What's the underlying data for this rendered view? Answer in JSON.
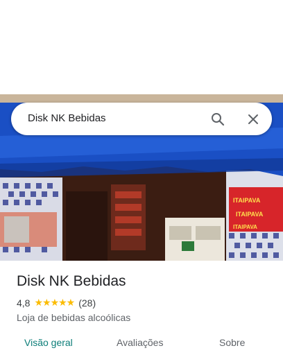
{
  "search": {
    "value": "Disk NK Bebidas"
  },
  "place": {
    "name": "Disk NK Bebidas",
    "rating": "4,8",
    "stars": "★★★★★",
    "review_count": "(28)",
    "category": "Loja de bebidas alcoólicas"
  },
  "tabs": [
    {
      "label": "Visão geral",
      "active": true
    },
    {
      "label": "Avaliações",
      "active": false
    },
    {
      "label": "Sobre",
      "active": false
    }
  ],
  "photo": {
    "signs": [
      "ITAIPAVA",
      "ITAIPAVA",
      "ITAIPAVA"
    ]
  },
  "colors": {
    "accent": "#0b7d78",
    "star": "#fbbc04",
    "awning": "#1a4fc4"
  }
}
